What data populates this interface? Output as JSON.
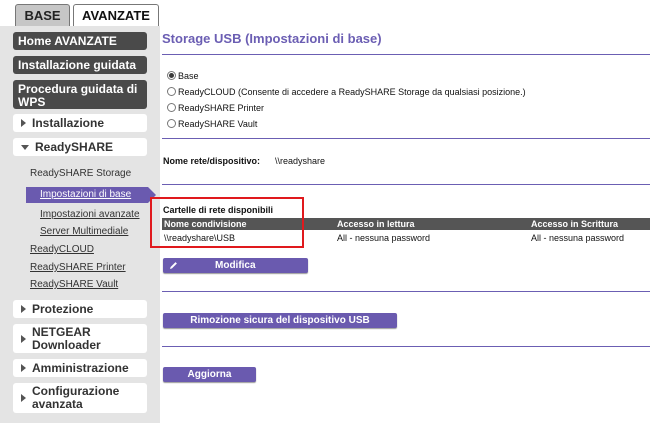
{
  "tabs": {
    "base": "BASE",
    "advanced": "AVANZATE"
  },
  "sidebar": {
    "home": "Home AVANZATE",
    "setup_wizard": "Installazione guidata",
    "wps_wizard": "Procedura guidata di WPS",
    "setup": "Installazione",
    "readyshare": "ReadySHARE",
    "readyshare_storage": "ReadySHARE Storage",
    "basic_settings": "Impostazioni di base",
    "advanced_settings": "Impostazioni avanzate",
    "media_server": "Server Multimediale",
    "readycloud": "ReadyCLOUD",
    "readyshare_printer": "ReadySHARE Printer",
    "readyshare_vault": "ReadySHARE Vault",
    "security": "Protezione",
    "netgear_downloader": "NETGEAR Downloader",
    "administration": "Amministrazione",
    "advanced_config": "Configurazione avanzata"
  },
  "main": {
    "title": "Storage USB (Impostazioni di base)",
    "options": [
      {
        "label": "Base",
        "checked": true
      },
      {
        "label": "ReadyCLOUD (Consente di accedere a ReadySHARE Storage da qualsiasi posizione.)",
        "checked": false
      },
      {
        "label": "ReadySHARE Printer",
        "checked": false
      },
      {
        "label": "ReadySHARE Vault",
        "checked": false
      }
    ],
    "device_name_label": "Nome rete/dispositivo:",
    "device_name_value": "\\\\readyshare",
    "shares_title": "Cartelle di rete disponibili",
    "table": {
      "headers": [
        "Nome condivisione",
        "Accesso in lettura",
        "Accesso in Scrittura"
      ],
      "rows": [
        [
          "\\\\readyshare\\USB",
          "All - nessuna password",
          "All - nessuna password"
        ]
      ]
    },
    "edit_button": "Modifica",
    "eject_button": "Rimozione sicura del dispositivo USB",
    "refresh_button": "Aggiorna"
  },
  "colors": {
    "accent": "#6a5aaf",
    "title": "#6b5eb3",
    "highlight_box": "#e0191d"
  },
  "icons": [
    "pencil-icon"
  ]
}
